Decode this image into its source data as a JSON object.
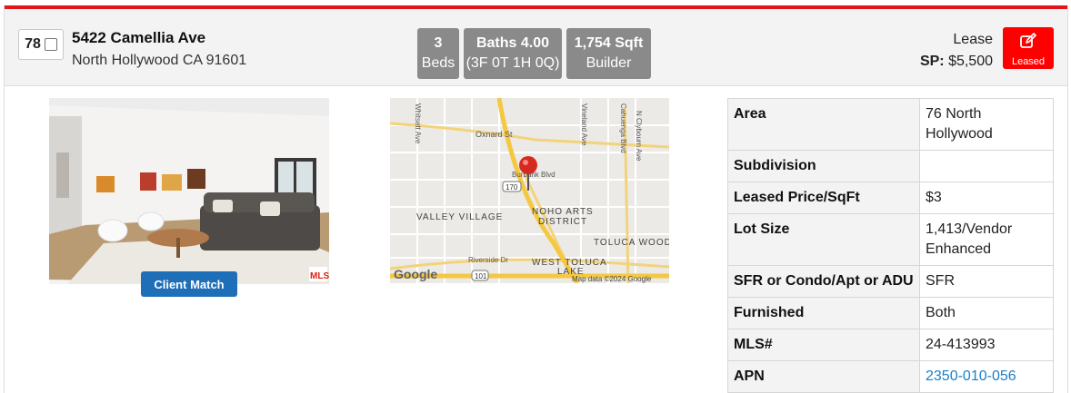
{
  "listing": {
    "index": "78",
    "street": "5422 Camellia Ave",
    "city_line": "North Hollywood CA 91601",
    "beds_value": "3",
    "beds_label": "Beds",
    "baths_value": "Baths 4.00",
    "baths_detail": "(3F 0T 1H 0Q)",
    "sqft_value": "1,754 Sqft",
    "sqft_source": "Builder",
    "type": "Lease",
    "price_label": "SP:",
    "price": "$5,500",
    "status_button": "Leased",
    "client_match": "Client Match"
  },
  "map": {
    "labels": [
      "Whitsett Ave",
      "Oxnard St",
      "Vineland Ave",
      "Cahuenga Blvd",
      "N Clybourn Ave",
      "Burbank Blvd",
      "VALLEY VILLAGE",
      "NOHO ARTS",
      "DISTRICT",
      "TOLUCA WOOD",
      "Riverside Dr",
      "WEST TOLUCA",
      "LAKE",
      "Map data ©2024 Google",
      "Google"
    ],
    "shields": [
      "170",
      "101"
    ]
  },
  "details": [
    {
      "key": "Area",
      "value": "76 North Hollywood"
    },
    {
      "key": "Subdivision",
      "value": ""
    },
    {
      "key": "Leased Price/SqFt",
      "value": "$3"
    },
    {
      "key": "Lot Size",
      "value": "1,413/Vendor Enhanced"
    },
    {
      "key": "SFR or Condo/Apt or ADU",
      "value": "SFR"
    },
    {
      "key": "Furnished",
      "value": "Both"
    },
    {
      "key": "MLS#",
      "value": "24-413993"
    },
    {
      "key": "APN",
      "value": "2350-010-056"
    }
  ],
  "colors": {
    "accent": "#e2151b",
    "button": "#1f6fb8",
    "link": "#1a7fc9",
    "stat_bg": "#8a8a8a"
  }
}
